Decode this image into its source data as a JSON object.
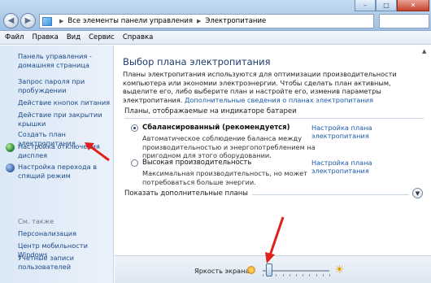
{
  "window": {
    "breadcrumb": [
      "Все элементы панели управления",
      "Электропитание"
    ],
    "buttons": {
      "minimize": "–",
      "maximize": "□",
      "close": "✕"
    }
  },
  "menu": [
    "Файл",
    "Правка",
    "Вид",
    "Сервис",
    "Справка"
  ],
  "sidebar": {
    "links": [
      {
        "label": "Панель управления -\nдомашняя страница"
      },
      {
        "label": "Запрос пароля при\nпробуждении"
      },
      {
        "label": "Действие кнопок питания"
      },
      {
        "label": "Действие при закрытии\nкрышки"
      },
      {
        "label": "Создать план электропитания"
      },
      {
        "label": "Настройка отключения\nдисплея",
        "icon": "globe-icon"
      },
      {
        "label": "Настройка перехода в\nспящий режим",
        "icon": "moon-icon"
      }
    ],
    "see_also_label": "См. также",
    "see_also": [
      "Персонализация",
      "Центр мобильности Windows",
      "Учетные записи\nпользователей"
    ]
  },
  "main": {
    "title": "Выбор плана электропитания",
    "intro_text": "Планы электропитания используются для оптимизации производительности компьютера или экономии электроэнергии. Чтобы сделать план активным, выделите его, либо выберите план и настройте его, изменив параметры электропитания.",
    "intro_link": "Дополнительные сведения о планах электропитания",
    "plans_header": "Планы, отображаемые на индикаторе батареи",
    "plans": [
      {
        "name": "Сбалансированный (рекомендуется)",
        "selected": true,
        "desc": "Автоматическое соблюдение баланса между производительностью и энергопотреблением на пригодном для этого оборудовании.",
        "link": "Настройка плана электропитания"
      },
      {
        "name": "Высокая производительность",
        "selected": false,
        "desc": "Максимальная производительность, но может потребоваться больше энергии.",
        "link": "Настройка плана электропитания"
      }
    ],
    "show_more": "Показать дополнительные планы"
  },
  "brightness": {
    "label": "Яркость экрана:",
    "value_fraction": 0.1
  },
  "colors": {
    "annotation_arrow": "#e0201b",
    "link": "#1d5aa8"
  }
}
